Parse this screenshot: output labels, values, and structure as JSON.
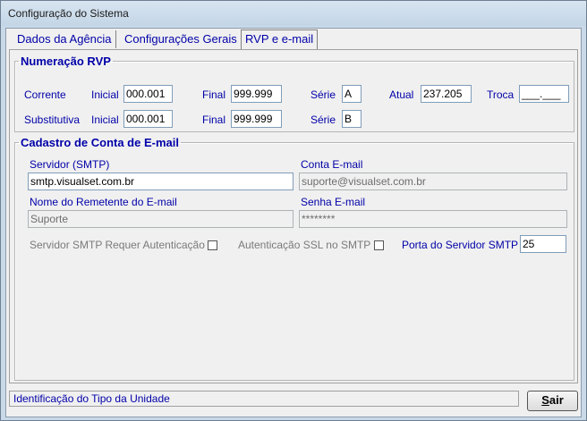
{
  "window": {
    "title": "Configuração do Sistema"
  },
  "tabs": [
    {
      "label": "Dados da Agência"
    },
    {
      "label": "Configurações Gerais"
    },
    {
      "label": "RVP e e-mail"
    }
  ],
  "rvp": {
    "legend": "Numeração RVP",
    "corrente": {
      "label": "Corrente",
      "inicial_label": "Inicial",
      "inicial": "000.001",
      "final_label": "Final",
      "final": "999.999",
      "serie_label": "Série",
      "serie": "A",
      "atual_label": "Atual",
      "atual": "237.205",
      "troca_label": "Troca",
      "troca": "___.___"
    },
    "substitutiva": {
      "label": "Substitutiva",
      "inicial_label": "Inicial",
      "inicial": "000.001",
      "final_label": "Final",
      "final": "999.999",
      "serie_label": "Série",
      "serie": "B"
    }
  },
  "email": {
    "legend": "Cadastro de Conta de E-mail",
    "servidor_label": "Servidor (SMTP)",
    "servidor": "smtp.visualset.com.br",
    "conta_label": "Conta E-mail",
    "conta": "suporte@visualset.com.br",
    "remetente_label": "Nome do Remetente do E-mail",
    "remetente": "Suporte",
    "senha_label": "Senha E-mail",
    "senha": "********",
    "auth_label": "Servidor SMTP Requer Autenticação",
    "ssl_label": "Autenticação SSL no SMTP",
    "porta_label": "Porta do Servidor SMTP",
    "porta": "25"
  },
  "status": {
    "text": "Identificação do Tipo da Unidade"
  },
  "exit_button": {
    "prefix": "",
    "accel": "S",
    "rest": "air"
  }
}
